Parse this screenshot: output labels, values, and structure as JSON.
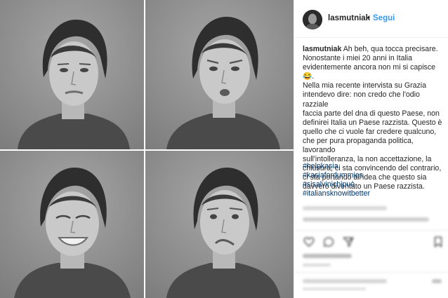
{
  "post": {
    "username": "lasmutniak",
    "separator": "•",
    "follow_label": "Segui",
    "caption_user": "lasmutniak",
    "caption_lines": [
      "Ah beh, qua tocca precisare.",
      "Nonostante i miei 20 anni in Italia",
      "evidentemente ancora non mi si capisce 😂.",
      "Nella mia recente intervista su Grazia",
      "intendevo dire: non credo che l'odio razziale",
      "faccia parte del dna di questo Paese, non",
      "definirei Italia un Paese razzista. Questo è",
      "quello che ci vuole far credere qualcuno,",
      "che per pura propaganda politica, lavorando",
      "sull'intolleranza, la non accettazione, la",
      "chiusura, ci sta convincendo del contrario,",
      "ci sta portando all'idea che questo sia",
      "davvero diventato un Paese razzista."
    ],
    "hashtags": [
      "#helpkasia",
      "#kasiafordummies",
      "#sisalvinichipuò",
      "#italiansknowitbetter"
    ]
  },
  "icons": {
    "avatar": "profile-avatar",
    "heart": "heart-icon",
    "comment": "comment-icon",
    "share": "share-icon",
    "bookmark": "bookmark-icon"
  },
  "photos": [
    {
      "expression": "neutral"
    },
    {
      "expression": "frowning"
    },
    {
      "expression": "squinting-smile"
    },
    {
      "expression": "grimace"
    }
  ],
  "colors": {
    "link": "#3897f0",
    "hashtag": "#003569",
    "text": "#262626",
    "photo_background": "#8f8f8f"
  }
}
